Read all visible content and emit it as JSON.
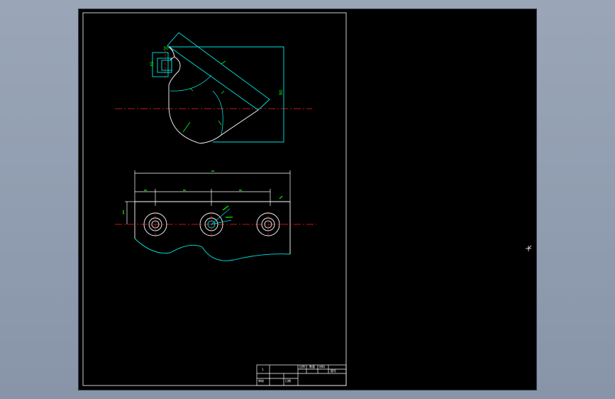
{
  "viewport": {
    "background": "#000000",
    "cursor_icon": "crosshair-cursor-icon"
  },
  "colors": {
    "outline": "#00e5e5",
    "dimension": "#00ff00",
    "centerline": "#ff2020",
    "frame": "#ffffff",
    "geometry_white": "#ffffff"
  },
  "drawing": {
    "top_view": {
      "dimension_labels": [
        "30",
        "45",
        "90"
      ]
    },
    "front_view": {
      "hole_count": 3
    },
    "title_block": {
      "cells": [
        "1",
        "比例",
        "数量",
        "材料",
        "图号",
        "审核",
        "日期"
      ]
    }
  }
}
